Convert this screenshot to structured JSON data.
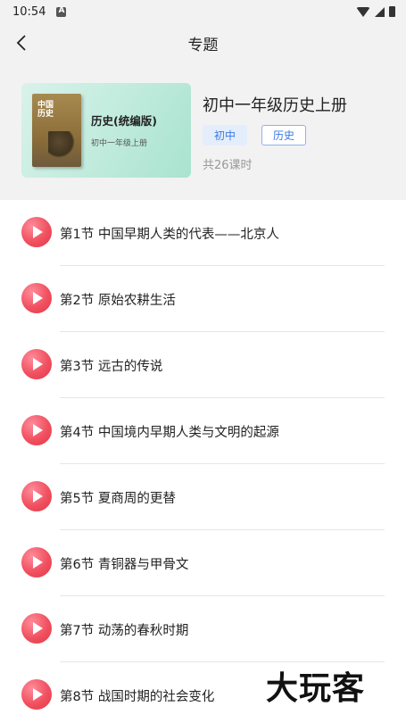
{
  "status_bar": {
    "time": "10:54"
  },
  "header": {
    "title": "专题",
    "back_icon": "chevron-left-icon"
  },
  "course": {
    "cover_title": "历史(统编版)",
    "cover_subtitle": "初中一年级上册",
    "cover_book_title": "中国历史",
    "name": "初中一年级历史上册",
    "tags": [
      "初中",
      "历史"
    ],
    "lesson_count": "共26课时"
  },
  "lessons": [
    {
      "label": "第1节  中国早期人类的代表——北京人"
    },
    {
      "label": "第2节  原始农耕生活"
    },
    {
      "label": "第3节  远古的传说"
    },
    {
      "label": "第4节  中国境内早期人类与文明的起源"
    },
    {
      "label": "第5节  夏商周的更替"
    },
    {
      "label": "第6节  青铜器与甲骨文"
    },
    {
      "label": "第7节  动荡的春秋时期"
    },
    {
      "label": "第8节  战国时期的社会变化"
    }
  ],
  "watermark": "大玩客",
  "colors": {
    "play_button": "#f0505f",
    "tag_text": "#3b7be0",
    "header_bg": "#f2f2f2"
  }
}
